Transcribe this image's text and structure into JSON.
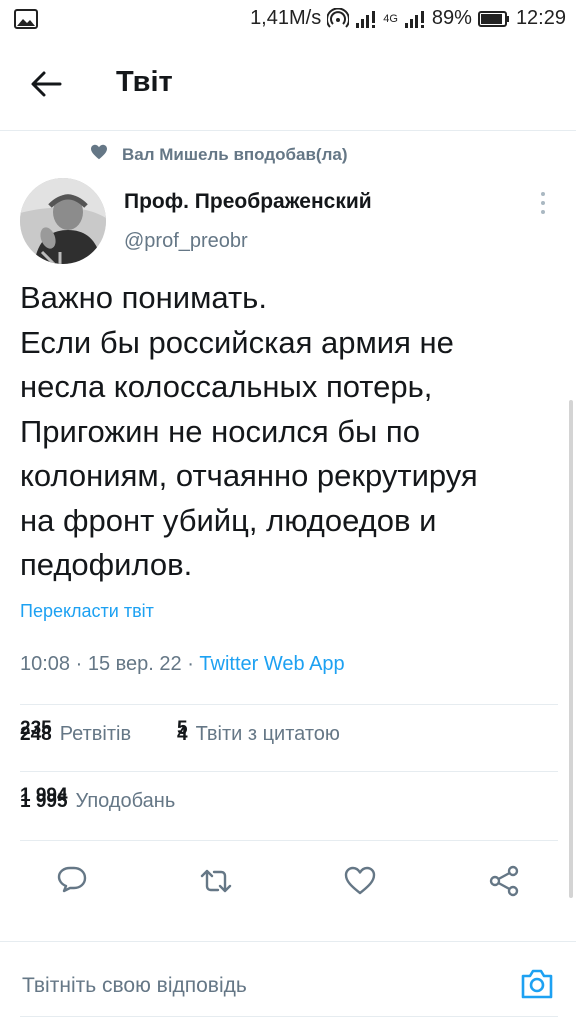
{
  "status_bar": {
    "network_speed": "1,41M/s",
    "network_type": "4G",
    "battery": "89%",
    "time": "12:29",
    "icons": [
      "image-icon",
      "hotspot-icon",
      "signal-icon",
      "battery-icon"
    ]
  },
  "header": {
    "title": "Твіт",
    "back_icon": "arrow-left-icon"
  },
  "social_context": {
    "icon": "heart-icon",
    "text": "Вал Мишель вподобав(ла)"
  },
  "author": {
    "name": "Проф. Преображенский",
    "handle": "@prof_preobr"
  },
  "tweet": {
    "lines": [
      "Важно понимать.",
      "Если бы российская армия не",
      "несла колоссальных потерь,",
      "Пригожин не носился бы по",
      "колониям, отчаянно рекрутируя",
      "на фронт убийц, людоедов и",
      "педофилов."
    ],
    "translate_label": "Перекласти твіт",
    "timestamp": "10:08 · 15 вер. 22 · ",
    "source": "Twitter Web App"
  },
  "stats": {
    "retweets_old": "235",
    "retweets": "248",
    "retweets_label": "Ретвітів",
    "quotes_old": "5",
    "quotes": "4",
    "quotes_label": "Твіти з цитатою",
    "likes_old": "1 994",
    "likes": "1 995",
    "likes_label": "Уподобань"
  },
  "actions": [
    "reply-icon",
    "retweet-icon",
    "like-icon",
    "share-icon"
  ],
  "reply": {
    "placeholder": "Твітніть свою відповідь",
    "camera_icon": "camera-icon"
  },
  "colors": {
    "accent": "#1da1f2",
    "text_primary": "#14171a",
    "text_secondary": "#657786",
    "divider": "#e6ecf0"
  }
}
